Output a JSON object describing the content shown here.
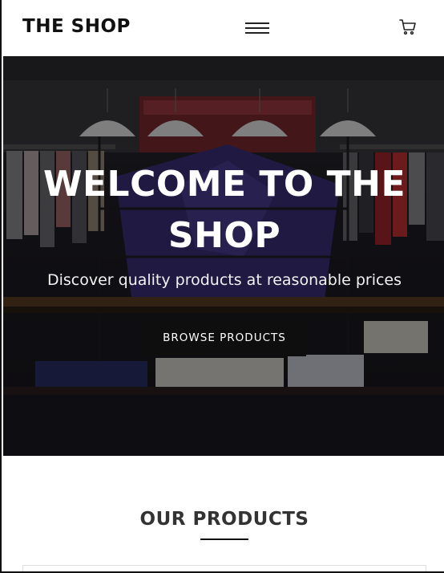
{
  "header": {
    "logo": "THE SHOP",
    "menu_icon": "hamburger-menu-icon",
    "cart_icon": "shopping-cart-icon"
  },
  "hero": {
    "title": "WELCOME TO THE SHOP",
    "subtitle": "Discover quality products at reasonable prices",
    "button_label": "BROWSE PRODUCTS",
    "overlay_color": "#000000"
  },
  "products": {
    "heading": "OUR PRODUCTS"
  },
  "colors": {
    "text_dark": "#111111",
    "button_bg": "#0e0e0e",
    "button_text": "#ffffff",
    "background": "#ffffff"
  }
}
